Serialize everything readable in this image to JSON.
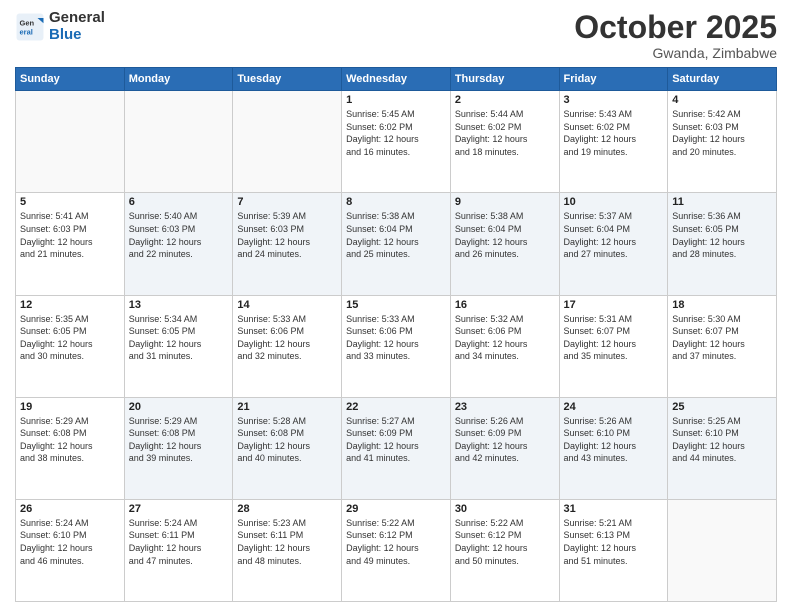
{
  "header": {
    "logo_general": "General",
    "logo_blue": "Blue",
    "month_title": "October 2025",
    "location": "Gwanda, Zimbabwe"
  },
  "weekdays": [
    "Sunday",
    "Monday",
    "Tuesday",
    "Wednesday",
    "Thursday",
    "Friday",
    "Saturday"
  ],
  "weeks": [
    [
      {
        "day": "",
        "info": ""
      },
      {
        "day": "",
        "info": ""
      },
      {
        "day": "",
        "info": ""
      },
      {
        "day": "1",
        "info": "Sunrise: 5:45 AM\nSunset: 6:02 PM\nDaylight: 12 hours\nand 16 minutes."
      },
      {
        "day": "2",
        "info": "Sunrise: 5:44 AM\nSunset: 6:02 PM\nDaylight: 12 hours\nand 18 minutes."
      },
      {
        "day": "3",
        "info": "Sunrise: 5:43 AM\nSunset: 6:02 PM\nDaylight: 12 hours\nand 19 minutes."
      },
      {
        "day": "4",
        "info": "Sunrise: 5:42 AM\nSunset: 6:03 PM\nDaylight: 12 hours\nand 20 minutes."
      }
    ],
    [
      {
        "day": "5",
        "info": "Sunrise: 5:41 AM\nSunset: 6:03 PM\nDaylight: 12 hours\nand 21 minutes."
      },
      {
        "day": "6",
        "info": "Sunrise: 5:40 AM\nSunset: 6:03 PM\nDaylight: 12 hours\nand 22 minutes."
      },
      {
        "day": "7",
        "info": "Sunrise: 5:39 AM\nSunset: 6:03 PM\nDaylight: 12 hours\nand 24 minutes."
      },
      {
        "day": "8",
        "info": "Sunrise: 5:38 AM\nSunset: 6:04 PM\nDaylight: 12 hours\nand 25 minutes."
      },
      {
        "day": "9",
        "info": "Sunrise: 5:38 AM\nSunset: 6:04 PM\nDaylight: 12 hours\nand 26 minutes."
      },
      {
        "day": "10",
        "info": "Sunrise: 5:37 AM\nSunset: 6:04 PM\nDaylight: 12 hours\nand 27 minutes."
      },
      {
        "day": "11",
        "info": "Sunrise: 5:36 AM\nSunset: 6:05 PM\nDaylight: 12 hours\nand 28 minutes."
      }
    ],
    [
      {
        "day": "12",
        "info": "Sunrise: 5:35 AM\nSunset: 6:05 PM\nDaylight: 12 hours\nand 30 minutes."
      },
      {
        "day": "13",
        "info": "Sunrise: 5:34 AM\nSunset: 6:05 PM\nDaylight: 12 hours\nand 31 minutes."
      },
      {
        "day": "14",
        "info": "Sunrise: 5:33 AM\nSunset: 6:06 PM\nDaylight: 12 hours\nand 32 minutes."
      },
      {
        "day": "15",
        "info": "Sunrise: 5:33 AM\nSunset: 6:06 PM\nDaylight: 12 hours\nand 33 minutes."
      },
      {
        "day": "16",
        "info": "Sunrise: 5:32 AM\nSunset: 6:06 PM\nDaylight: 12 hours\nand 34 minutes."
      },
      {
        "day": "17",
        "info": "Sunrise: 5:31 AM\nSunset: 6:07 PM\nDaylight: 12 hours\nand 35 minutes."
      },
      {
        "day": "18",
        "info": "Sunrise: 5:30 AM\nSunset: 6:07 PM\nDaylight: 12 hours\nand 37 minutes."
      }
    ],
    [
      {
        "day": "19",
        "info": "Sunrise: 5:29 AM\nSunset: 6:08 PM\nDaylight: 12 hours\nand 38 minutes."
      },
      {
        "day": "20",
        "info": "Sunrise: 5:29 AM\nSunset: 6:08 PM\nDaylight: 12 hours\nand 39 minutes."
      },
      {
        "day": "21",
        "info": "Sunrise: 5:28 AM\nSunset: 6:08 PM\nDaylight: 12 hours\nand 40 minutes."
      },
      {
        "day": "22",
        "info": "Sunrise: 5:27 AM\nSunset: 6:09 PM\nDaylight: 12 hours\nand 41 minutes."
      },
      {
        "day": "23",
        "info": "Sunrise: 5:26 AM\nSunset: 6:09 PM\nDaylight: 12 hours\nand 42 minutes."
      },
      {
        "day": "24",
        "info": "Sunrise: 5:26 AM\nSunset: 6:10 PM\nDaylight: 12 hours\nand 43 minutes."
      },
      {
        "day": "25",
        "info": "Sunrise: 5:25 AM\nSunset: 6:10 PM\nDaylight: 12 hours\nand 44 minutes."
      }
    ],
    [
      {
        "day": "26",
        "info": "Sunrise: 5:24 AM\nSunset: 6:10 PM\nDaylight: 12 hours\nand 46 minutes."
      },
      {
        "day": "27",
        "info": "Sunrise: 5:24 AM\nSunset: 6:11 PM\nDaylight: 12 hours\nand 47 minutes."
      },
      {
        "day": "28",
        "info": "Sunrise: 5:23 AM\nSunset: 6:11 PM\nDaylight: 12 hours\nand 48 minutes."
      },
      {
        "day": "29",
        "info": "Sunrise: 5:22 AM\nSunset: 6:12 PM\nDaylight: 12 hours\nand 49 minutes."
      },
      {
        "day": "30",
        "info": "Sunrise: 5:22 AM\nSunset: 6:12 PM\nDaylight: 12 hours\nand 50 minutes."
      },
      {
        "day": "31",
        "info": "Sunrise: 5:21 AM\nSunset: 6:13 PM\nDaylight: 12 hours\nand 51 minutes."
      },
      {
        "day": "",
        "info": ""
      }
    ]
  ]
}
